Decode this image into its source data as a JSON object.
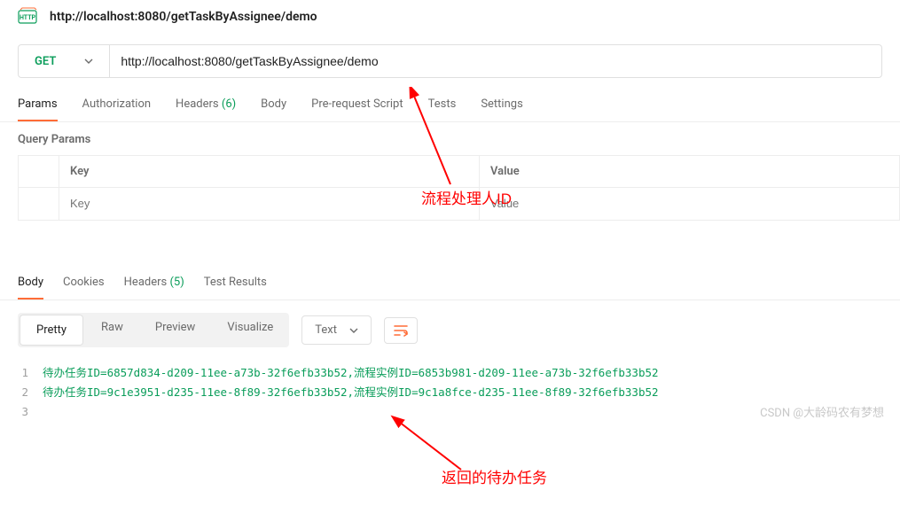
{
  "header": {
    "url_title": "http://localhost:8080/getTaskByAssignee/demo"
  },
  "request": {
    "method": "GET",
    "url": "http://localhost:8080/getTaskByAssignee/demo"
  },
  "request_tabs": {
    "params": "Params",
    "authorization": "Authorization",
    "headers": "Headers",
    "headers_count": "(6)",
    "body": "Body",
    "prerequest": "Pre-request Script",
    "tests": "Tests",
    "settings": "Settings"
  },
  "params": {
    "section_label": "Query Params",
    "key_header": "Key",
    "value_header": "Value",
    "key_placeholder": "Key",
    "value_placeholder": "Value"
  },
  "response_tabs": {
    "body": "Body",
    "cookies": "Cookies",
    "headers": "Headers",
    "headers_count": "(5)",
    "test_results": "Test Results"
  },
  "view_modes": {
    "pretty": "Pretty",
    "raw": "Raw",
    "preview": "Preview",
    "visualize": "Visualize"
  },
  "format": {
    "label": "Text"
  },
  "response_lines": [
    "待办任务ID=6857d834-d209-11ee-a73b-32f6efb33b52,流程实例ID=6853b981-d209-11ee-a73b-32f6efb33b52",
    "待办任务ID=9c1e3951-d235-11ee-8f89-32f6efb33b52,流程实例ID=9c1a8fce-d235-11ee-8f89-32f6efb33b52",
    ""
  ],
  "annotations": {
    "a1": "流程处理人ID",
    "a2": "返回的待办任务"
  },
  "watermark": "CSDN @大龄码农有梦想"
}
